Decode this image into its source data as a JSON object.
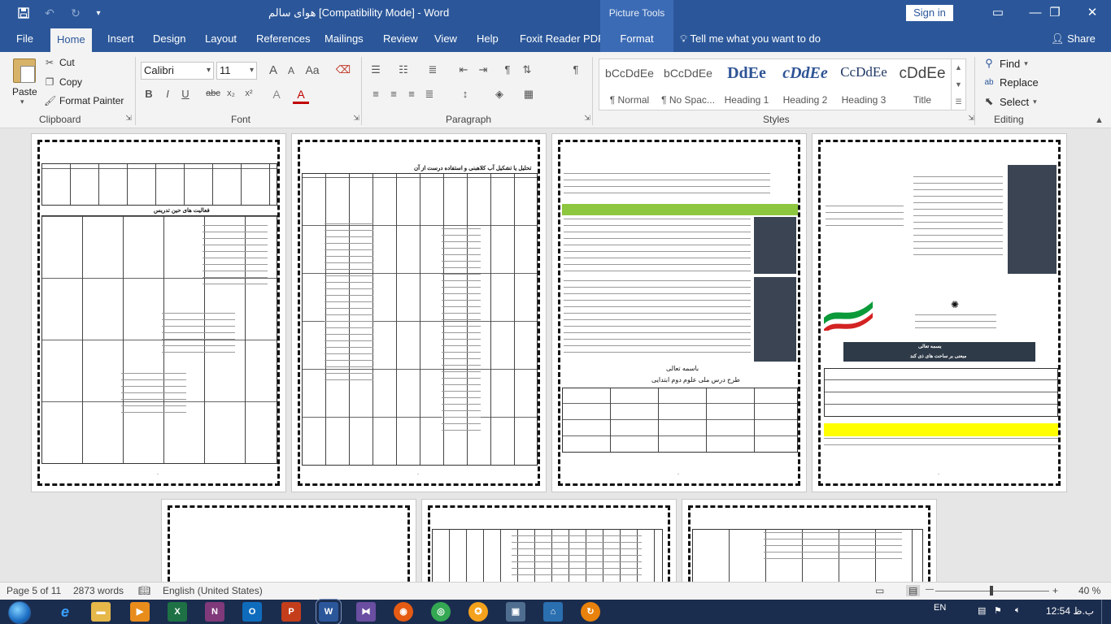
{
  "titlebar": {
    "doc_title": "هوای سالم [Compatibility Mode]  -  Word",
    "context_tab": "Picture Tools",
    "signin": "Sign in",
    "save_icon": "save-icon",
    "undo_icon": "undo-icon",
    "redo_icon": "redo-icon",
    "customize_icon": "customize-icon"
  },
  "tabs": [
    "File",
    "Home",
    "Insert",
    "Design",
    "Layout",
    "References",
    "Mailings",
    "Review",
    "View",
    "Help",
    "Foxit Reader PDF",
    "Format"
  ],
  "active_tab": "Home",
  "tellme": "Tell me what you want to do",
  "share": "Share",
  "ribbon": {
    "clipboard": {
      "label": "Clipboard",
      "paste": "Paste",
      "cut": "Cut",
      "copy": "Copy",
      "format_painter": "Format Painter"
    },
    "font": {
      "label": "Font",
      "font_name": "Calibri",
      "font_size": "11",
      "bold": "B",
      "italic": "I",
      "underline": "U",
      "strike": "abc",
      "subscript": "x₂",
      "superscript": "x²",
      "grow": "A",
      "shrink": "A",
      "case": "Aa",
      "text_effects": "A",
      "font_color": "A"
    },
    "paragraph": {
      "label": "Paragraph"
    },
    "styles": {
      "label": "Styles",
      "items": [
        {
          "sample": "bCcDdEe",
          "name": "¶ Normal"
        },
        {
          "sample": "bCcDdEe",
          "name": "¶ No Spac..."
        },
        {
          "sample": "DdEe",
          "name": "Heading 1"
        },
        {
          "sample": "cDdEe",
          "name": "Heading 2"
        },
        {
          "sample": "CcDdEe",
          "name": "Heading 3"
        },
        {
          "sample": "cDdEe",
          "name": "Title"
        }
      ]
    },
    "editing": {
      "label": "Editing",
      "find": "Find",
      "replace": "Replace",
      "select": "Select"
    }
  },
  "document": {
    "page1_header": "فعالیت های حین تدریس",
    "page2_header": "تحلیل یا تشکیل آب کلاهبنی و استفاده درست از آن",
    "page3_title1": "باسمه تعالی",
    "page3_title2": "طرح درس ملی علوم دوم  ابتدایی",
    "page4_title1": "بسمه تعالی",
    "page4_title2": "مبعنی بر ساحت های ذی کند"
  },
  "statusbar": {
    "page": "Page 5 of 11",
    "words": "2873 words",
    "language": "English (United States)",
    "zoom": "40 %"
  },
  "taskbar": {
    "lang": "EN",
    "time": "12:54 ب.ظ"
  }
}
